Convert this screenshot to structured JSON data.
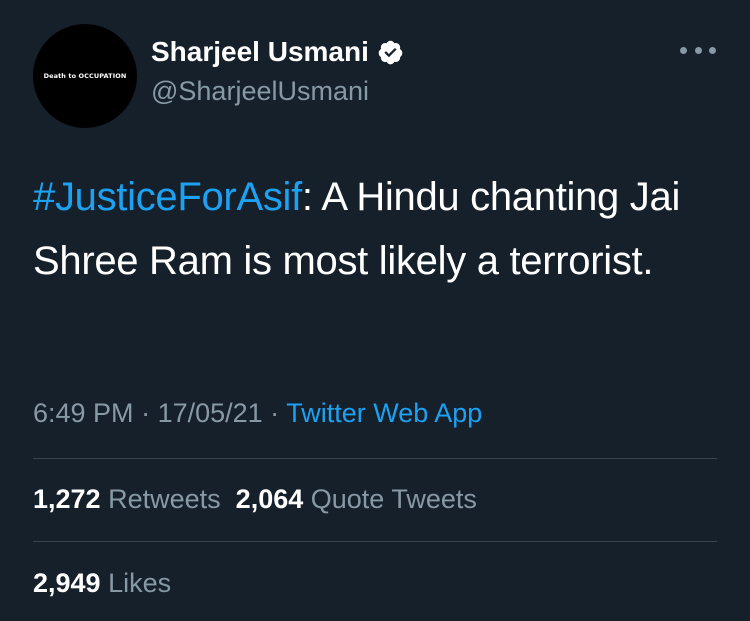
{
  "colors": {
    "background": "#15202b",
    "primary_text": "#ffffff",
    "secondary_text": "#8899a6",
    "accent": "#1da1f2",
    "divider": "#38444d"
  },
  "author": {
    "avatar_text": "Death to OCCUPATION",
    "display_name": "Sharjeel Usmani",
    "verified_icon": "verified-badge-icon",
    "handle": "@SharjeelUsmani"
  },
  "menu": {
    "icon": "more-options-icon"
  },
  "tweet": {
    "hashtag": "#JusticeForAsif",
    "text": ": A Hindu chanting Jai Shree Ram is most likely a terrorist."
  },
  "meta": {
    "time": "6:49 PM",
    "separator1": " · ",
    "date": "17/05/21",
    "separator2": " · ",
    "source": "Twitter Web App"
  },
  "stats": {
    "retweets_count": "1,272",
    "retweets_label": "Retweets",
    "quotes_count": "2,064",
    "quotes_label": "Quote Tweets",
    "likes_count": "2,949",
    "likes_label": "Likes"
  }
}
